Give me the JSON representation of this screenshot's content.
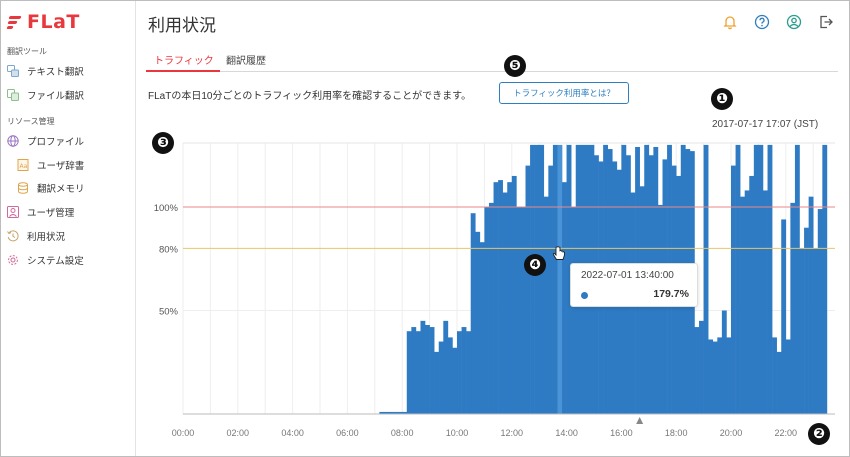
{
  "app": {
    "logo": "FLaT"
  },
  "sidebar": {
    "sections": [
      {
        "title": "翻訳ツール"
      },
      {
        "title": "リソース管理"
      }
    ],
    "items": [
      {
        "label": "テキスト翻訳",
        "icon": "text-translate-icon"
      },
      {
        "label": "ファイル翻訳",
        "icon": "file-translate-icon"
      },
      {
        "label": "プロファイル",
        "icon": "globe-icon"
      },
      {
        "label": "ユーザ辞書",
        "icon": "dictionary-icon"
      },
      {
        "label": "翻訳メモリ",
        "icon": "database-icon"
      },
      {
        "label": "ユーザ管理",
        "icon": "user-manage-icon"
      },
      {
        "label": "利用状況",
        "icon": "history-icon"
      },
      {
        "label": "システム設定",
        "icon": "settings-icon"
      }
    ]
  },
  "header": {
    "title": "利用状況",
    "icons": [
      "bell-icon",
      "help-icon",
      "account-icon",
      "logout-icon"
    ]
  },
  "tabs": [
    {
      "label": "トラフィック",
      "active": true
    },
    {
      "label": "翻訳履歴",
      "active": false
    }
  ],
  "main": {
    "description": "FLaTの本日10分ごとのトラフィック利用率を確認することができます。",
    "help_button": "トラフィック利用率とは？",
    "timestamp": "2017-07-17 17:07 (JST)"
  },
  "annotations": [
    "❶",
    "❷",
    "❸",
    "❹",
    "❺"
  ],
  "tooltip": {
    "time": "2022-07-01 13:40:00",
    "value": "179.7%"
  },
  "colors": {
    "accent": "#e8383d",
    "bar": "#2e7bc4",
    "line100": "#e88a8a",
    "line80": "#e6c46a"
  },
  "chart_data": {
    "type": "bar",
    "xlabel": "",
    "ylabel": "",
    "x_ticks": [
      "00:00",
      "02:00",
      "04:00",
      "06:00",
      "08:00",
      "10:00",
      "12:00",
      "14:00",
      "16:00",
      "18:00",
      "20:00",
      "22:00"
    ],
    "y_ticks": [
      "50%",
      "80%",
      "100%"
    ],
    "reference_lines": [
      100,
      80
    ],
    "ylim": [
      0,
      130
    ],
    "series": [
      {
        "interval_minutes": 10,
        "start": "07:10",
        "values": [
          1,
          1,
          1,
          1,
          1,
          1,
          40,
          42,
          40,
          45,
          43,
          42,
          30,
          35,
          45,
          37,
          32,
          40,
          42,
          40,
          97,
          88,
          83,
          100,
          102,
          112,
          113,
          107,
          112,
          115,
          100,
          100,
          120,
          130,
          130,
          130,
          105,
          120,
          130,
          130,
          112,
          130,
          100,
          130,
          130,
          130,
          130,
          125,
          122,
          130,
          128,
          122,
          118,
          130,
          125,
          107,
          129,
          110,
          130,
          125,
          129,
          101,
          123,
          130,
          120,
          115,
          130,
          128,
          127,
          42,
          45,
          130,
          36,
          35,
          37,
          50,
          37,
          120,
          130,
          105,
          108,
          115,
          130,
          130,
          108,
          130,
          37,
          30,
          94,
          36,
          102,
          130,
          80,
          90,
          105,
          80,
          99,
          130
        ]
      }
    ],
    "highlight": {
      "time": "13:40",
      "value": 179.7
    },
    "current_marker": "16:40"
  }
}
